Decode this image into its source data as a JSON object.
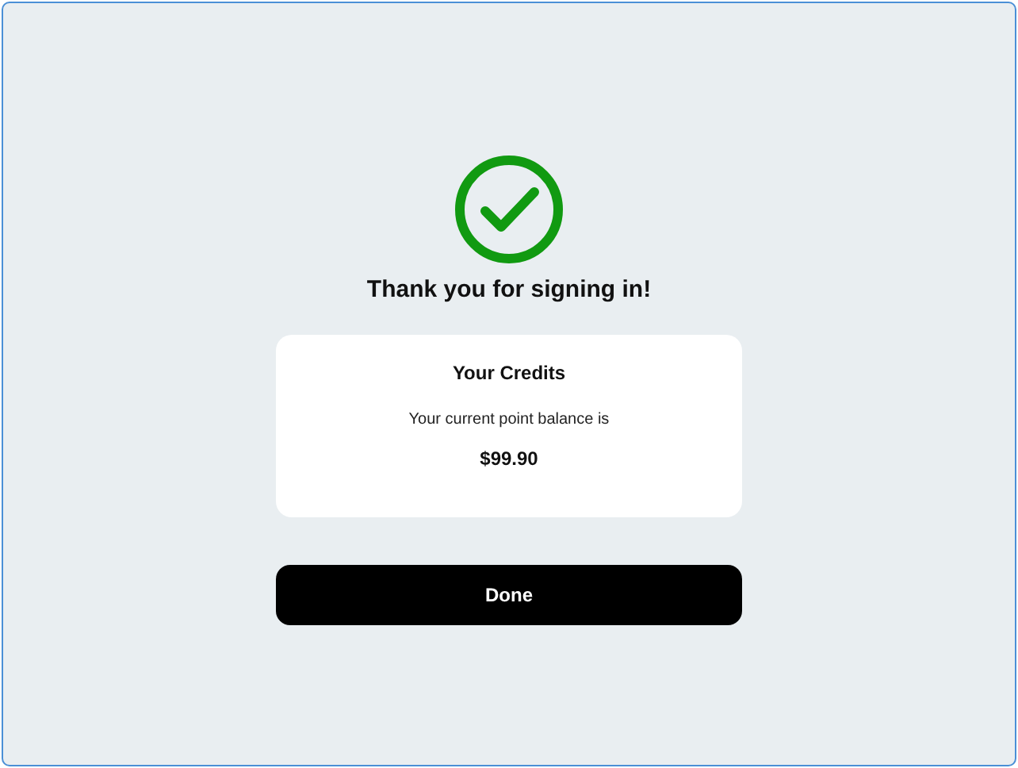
{
  "title": "Thank you for signing in!",
  "card": {
    "heading": "Your Credits",
    "text": "Your current point balance is",
    "amount": "$99.90"
  },
  "button": "Done"
}
